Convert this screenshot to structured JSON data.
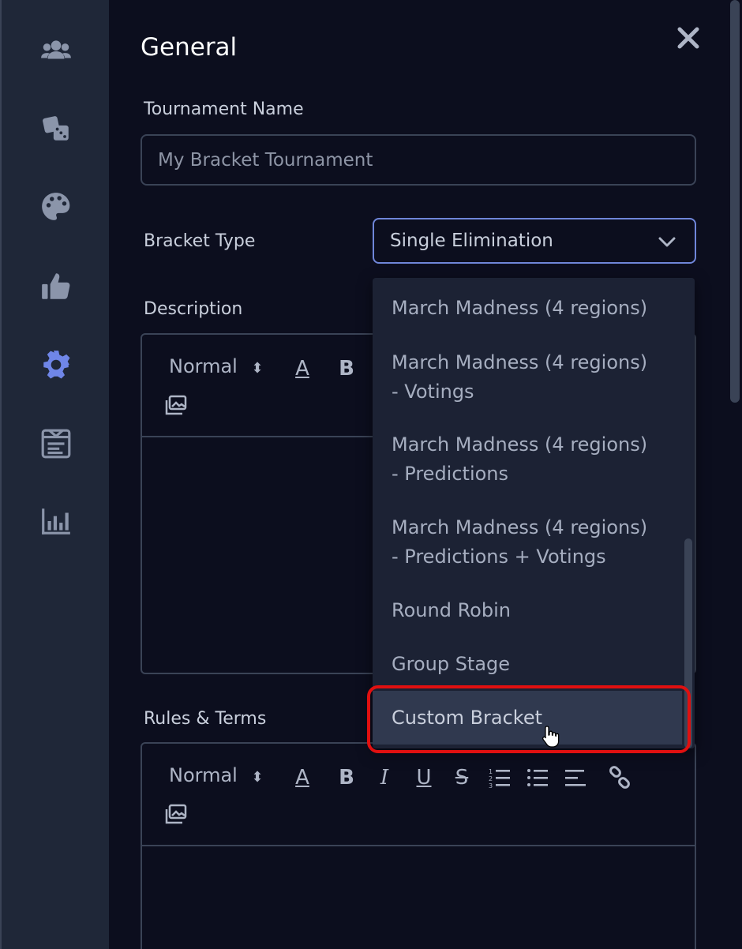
{
  "sidebar": {
    "icons": [
      "users-icon",
      "dice-icon",
      "palette-icon",
      "thumbs-up-icon",
      "gear-icon",
      "scoreboard-icon",
      "bar-chart-icon"
    ],
    "active": "gear-icon",
    "colors": {
      "default": "#8b95aa",
      "active": "#6f86e8"
    }
  },
  "panel": {
    "title": "General",
    "close_icon": "close-icon"
  },
  "form": {
    "name_label": "Tournament Name",
    "name_placeholder": "My Bracket Tournament",
    "bracket_label": "Bracket Type",
    "bracket_value": "Single Elimination",
    "description_label": "Description",
    "rules_label": "Rules & Terms"
  },
  "editor_toolbar": {
    "format": "Normal",
    "buttons": [
      "text-color",
      "bold",
      "italic",
      "underline",
      "strikethrough",
      "ordered-list",
      "bullet-list",
      "align",
      "link",
      "image"
    ]
  },
  "dropdown": {
    "options": [
      {
        "line1": "March Madness (4 regions)",
        "line2": ""
      },
      {
        "line1": "March Madness (4 regions)",
        "line2": "- Votings"
      },
      {
        "line1": "March Madness (4 regions)",
        "line2": "- Predictions"
      },
      {
        "line1": "March Madness (4 regions)",
        "line2": "- Predictions + Votings"
      },
      {
        "line1": "Round Robin",
        "line2": ""
      },
      {
        "line1": "Group Stage",
        "line2": ""
      },
      {
        "line1": "Custom Bracket",
        "line2": ""
      }
    ],
    "highlighted": "Custom Bracket",
    "highlight_color": "#e01010"
  }
}
